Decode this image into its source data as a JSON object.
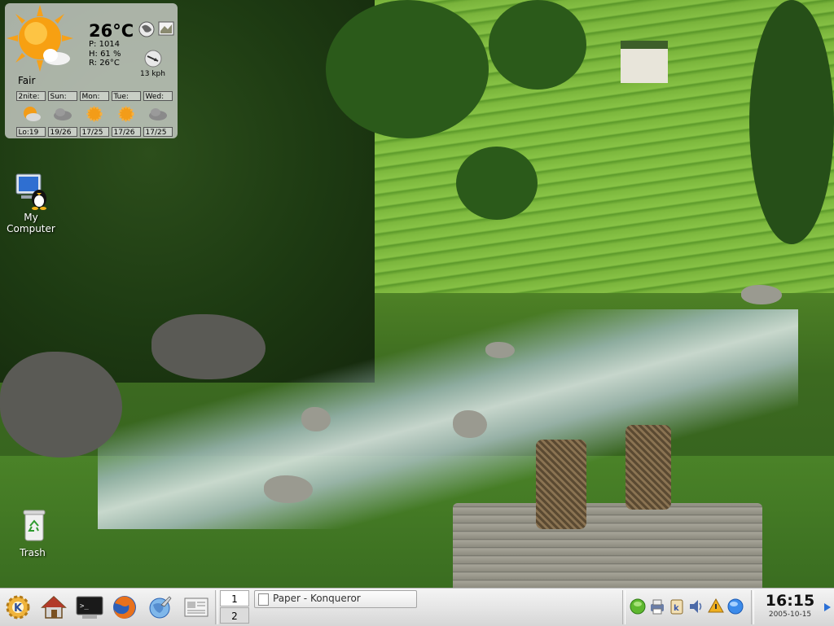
{
  "weather": {
    "temperature": "26°C",
    "pressure": "P: 1014",
    "humidity": "H: 61 %",
    "realfeel": "R: 26°C",
    "wind": "13 kph",
    "condition": "Fair",
    "forecast": [
      {
        "day": "2nite:",
        "temp": "Lo:19",
        "icon": "moon-cloud-icon"
      },
      {
        "day": "Sun:",
        "temp": "19/26",
        "icon": "cloud-icon"
      },
      {
        "day": "Mon:",
        "temp": "17/25",
        "icon": "sun-icon"
      },
      {
        "day": "Tue:",
        "temp": "17/26",
        "icon": "sun-icon"
      },
      {
        "day": "Wed:",
        "temp": "17/25",
        "icon": "cloud-icon"
      }
    ]
  },
  "desktop": {
    "my_computer_label": "My Computer",
    "trash_label": "Trash"
  },
  "taskbar": {
    "pager": [
      "1",
      "2"
    ],
    "task_label": "Paper - Konqueror",
    "clock_time": "16:15",
    "clock_date": "2005-10-15"
  },
  "colors": {
    "taskbar_bg": "#e6e6e6",
    "accent_blue": "#2a6fd6"
  }
}
